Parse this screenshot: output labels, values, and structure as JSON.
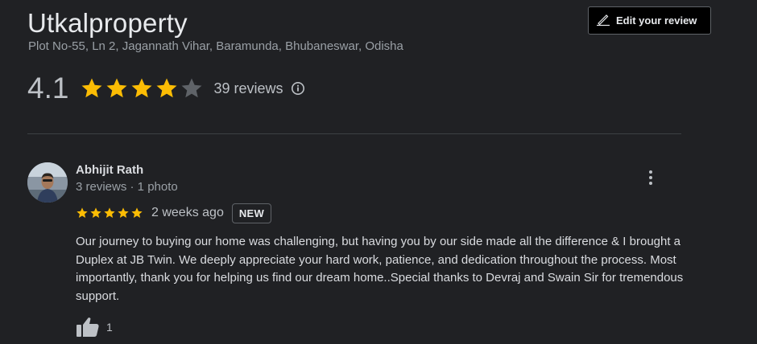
{
  "business": {
    "name": "Utkalproperty",
    "address": "Plot No-55, Ln 2, Jagannath Vihar, Baramunda, Bhubaneswar, Odisha",
    "rating": "4.1",
    "rating_value": 4.1,
    "rating_max": 5,
    "review_count_label": "39 reviews"
  },
  "edit_review": {
    "label": "Edit your review",
    "icon": "pencil-icon"
  },
  "colors": {
    "star_filled": "#fbbc04",
    "star_empty": "#5f6368",
    "background": "#202124"
  },
  "review": {
    "author": "Abhijit Rath",
    "author_meta": "3 reviews · 1 photo",
    "stars": 5,
    "date": "2 weeks ago",
    "badge": "NEW",
    "text": "Our journey to buying our home was challenging, but having you by our side made all the difference & I brought a Duplex at JB Twin. We deeply appreciate your hard work, patience, and dedication throughout the process. Most importantly, thank you for helping us find our dream home..Special thanks to Devraj and Swain Sir for tremendous support.",
    "likes": "1"
  }
}
